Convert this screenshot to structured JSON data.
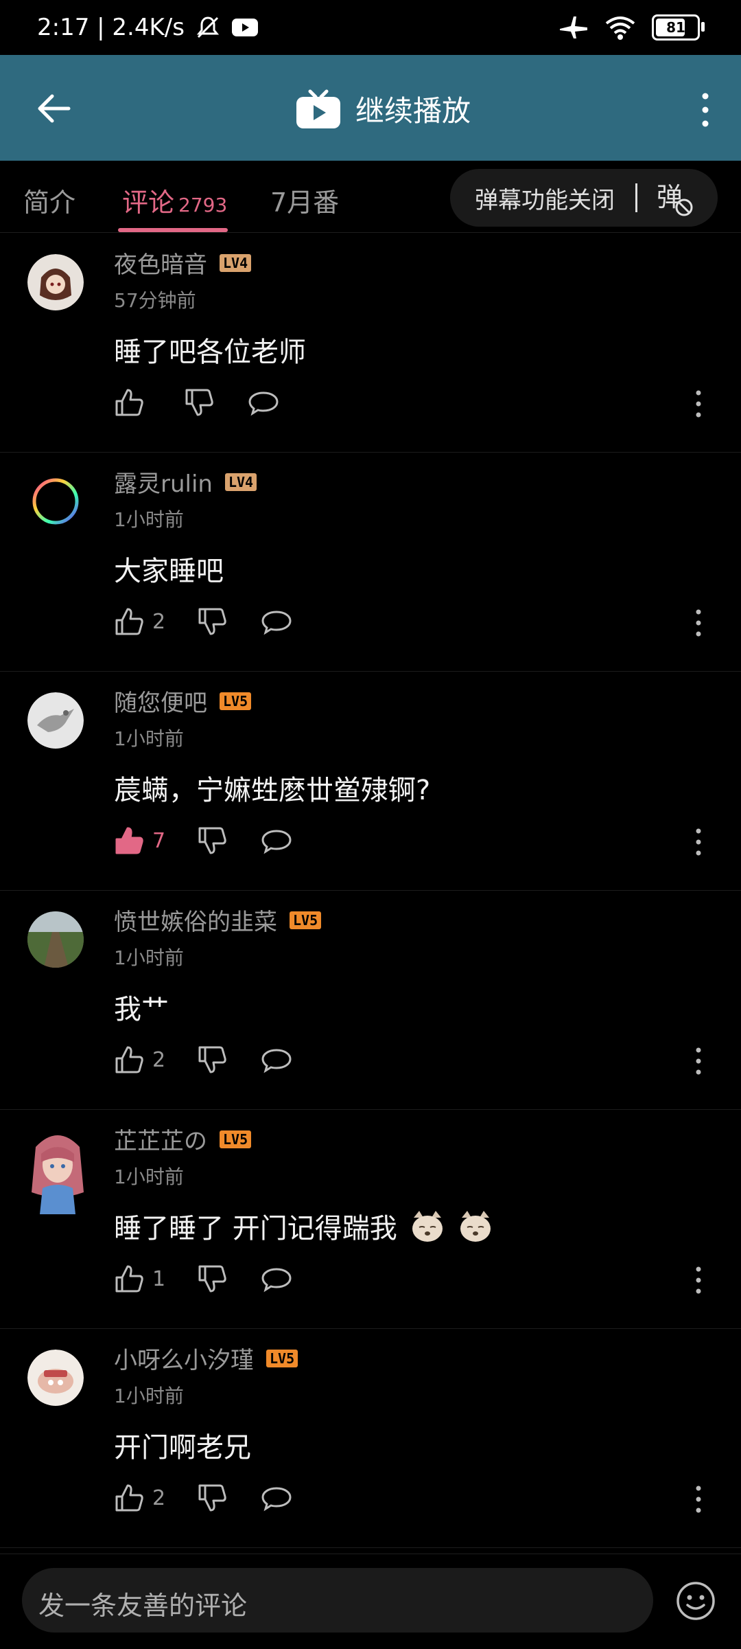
{
  "status_bar": {
    "time_speed": "2:17 | 2.4K/s",
    "battery": "81",
    "battery_level": 0.81
  },
  "header": {
    "title": "继续播放"
  },
  "tabs": [
    {
      "label": "简介"
    },
    {
      "label": "评论",
      "count": "2793"
    },
    {
      "label": "7月番"
    }
  ],
  "danmu": {
    "label": "弹幕功能关闭",
    "icon_text": "弹"
  },
  "comments": [
    {
      "name": "夜色暗音",
      "level": "LV4",
      "time": "57分钟前",
      "text": "睡了吧各位老师",
      "likes": ""
    },
    {
      "name": "露灵rulin",
      "level": "LV4",
      "time": "1小时前",
      "text": "大家睡吧",
      "likes": "2"
    },
    {
      "name": "随您便吧",
      "level": "LV5",
      "time": "1小时前",
      "text": "莀螨，宁嫲甡麽丗鲎殔锕?",
      "likes": "7",
      "liked": true
    },
    {
      "name": "愤世嫉俗的韭菜",
      "level": "LV5",
      "time": "1小时前",
      "text": "我艹",
      "likes": "2"
    },
    {
      "name": "芷芷芷の",
      "level": "LV5",
      "time": "1小时前",
      "text": "睡了睡了 开门记得踹我",
      "likes": "1"
    },
    {
      "name": "小呀么小汐瑾",
      "level": "LV5",
      "time": "1小时前",
      "text": "开门啊老兄",
      "likes": "2"
    }
  ],
  "bottom": {
    "placeholder": "发一条友善的评论"
  },
  "colors": {
    "header_bg": "#2f6a7f",
    "accent_pink": "#e26886",
    "lv4": "#d9a26d",
    "lv5": "#f08a2a"
  }
}
